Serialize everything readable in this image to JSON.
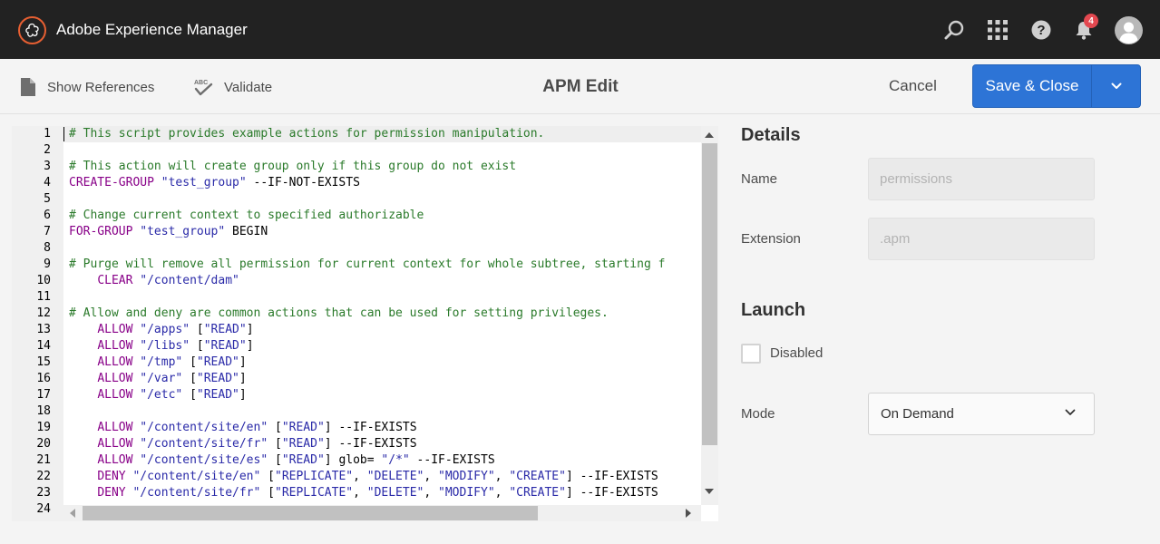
{
  "shell": {
    "app_title": "Adobe Experience Manager",
    "notification_count": "4",
    "icons": [
      "search-icon",
      "apps-grid-icon",
      "help-icon",
      "bell-icon",
      "avatar"
    ]
  },
  "actionbar": {
    "show_references": "Show References",
    "validate": "Validate",
    "title": "APM Edit",
    "cancel": "Cancel",
    "save_close": "Save & Close"
  },
  "editor": {
    "lines": [
      "# This script provides example actions for permission manipulation.",
      "",
      "# This action will create group only if this group do not exist",
      "CREATE-GROUP \"test_group\" --IF-NOT-EXISTS",
      "",
      "# Change current context to specified authorizable",
      "FOR-GROUP \"test_group\" BEGIN",
      "",
      "# Purge will remove all permission for current context for whole subtree, starting f",
      "    CLEAR \"/content/dam\"",
      "",
      "# Allow and deny are common actions that can be used for setting privileges.",
      "    ALLOW \"/apps\" [\"READ\"]",
      "    ALLOW \"/libs\" [\"READ\"]",
      "    ALLOW \"/tmp\" [\"READ\"]",
      "    ALLOW \"/var\" [\"READ\"]",
      "    ALLOW \"/etc\" [\"READ\"]",
      "",
      "    ALLOW \"/content/site/en\" [\"READ\"] --IF-EXISTS",
      "    ALLOW \"/content/site/fr\" [\"READ\"] --IF-EXISTS",
      "    ALLOW \"/content/site/es\" [\"READ\"] glob= \"/*\" --IF-EXISTS",
      "    DENY \"/content/site/en\" [\"REPLICATE\", \"DELETE\", \"MODIFY\", \"CREATE\"] --IF-EXISTS",
      "    DENY \"/content/site/fr\" [\"REPLICATE\", \"DELETE\", \"MODIFY\", \"CREATE\"] --IF-EXISTS",
      ""
    ],
    "line_numbers": [
      "1",
      "2",
      "3",
      "4",
      "5",
      "6",
      "7",
      "8",
      "9",
      "10",
      "11",
      "12",
      "13",
      "14",
      "15",
      "16",
      "17",
      "18",
      "19",
      "20",
      "21",
      "22",
      "23",
      "24"
    ]
  },
  "details": {
    "heading": "Details",
    "name_label": "Name",
    "name_value": "permissions",
    "extension_label": "Extension",
    "extension_value": ".apm"
  },
  "launch": {
    "heading": "Launch",
    "disabled_label": "Disabled",
    "mode_label": "Mode",
    "mode_value": "On Demand"
  },
  "colors": {
    "shell_bg": "#222222",
    "primary_button": "#2d74d6",
    "badge": "#e34850",
    "comment": "#2a7a2a",
    "keyword": "#880088",
    "string": "#2a2aa8"
  }
}
